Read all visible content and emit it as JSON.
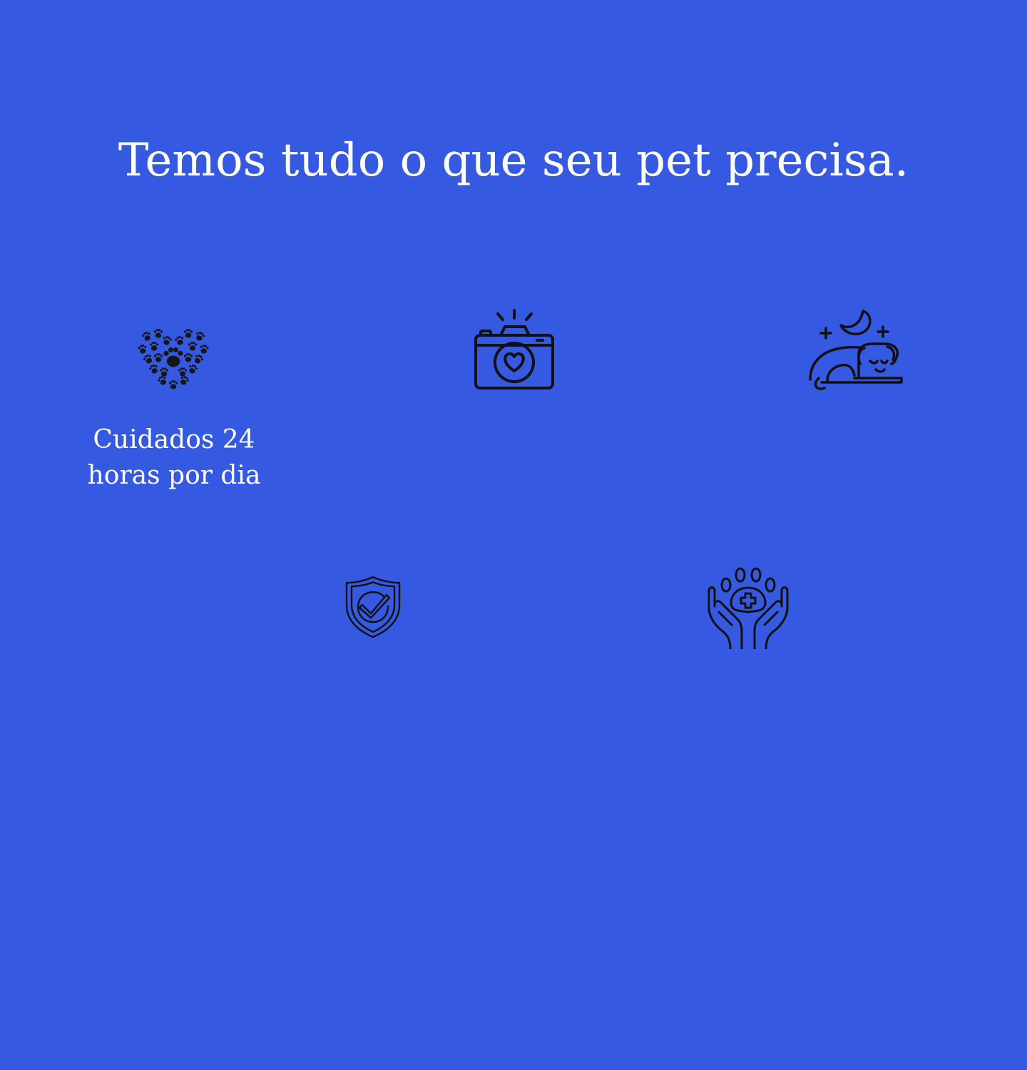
{
  "page": {
    "title": "Temos tudo o que seu pet precisa.",
    "background_color": "#3559e0",
    "text_color": "#ffffff",
    "icon_color": "#111111"
  },
  "features": [
    {
      "icon": "paw-heart-icon",
      "label": "Cuidados 24\nhoras por dia"
    },
    {
      "icon": "camera-heart-icon",
      "label": ""
    },
    {
      "icon": "sleeping-dog-icon",
      "label": ""
    },
    {
      "icon": "shield-check-icon",
      "label": ""
    },
    {
      "icon": "hands-paw-care-icon",
      "label": ""
    }
  ]
}
